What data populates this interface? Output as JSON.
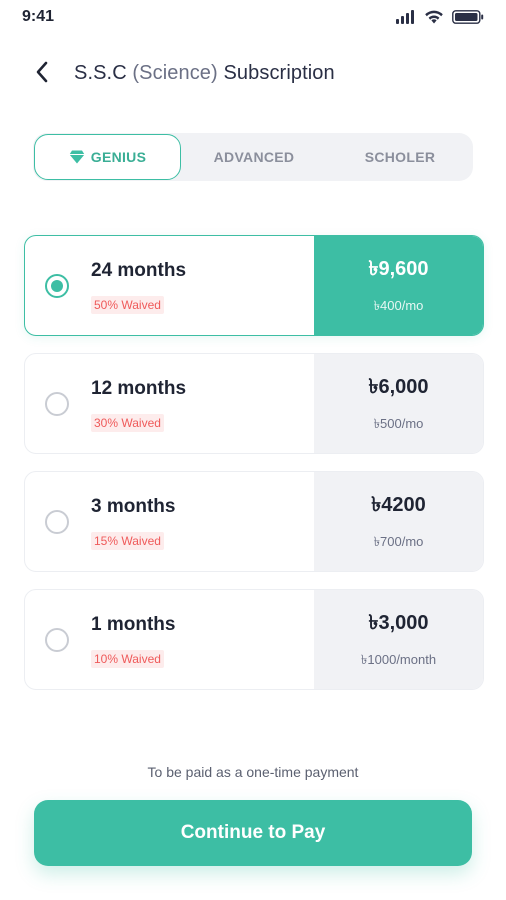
{
  "status_bar": {
    "time": "9:41"
  },
  "header": {
    "title_prefix": "S.S.C",
    "title_paren": "(Science)",
    "title_suffix": "Subscription"
  },
  "tabs": [
    {
      "label": "GENIUS",
      "active": true,
      "icon": "gem-icon"
    },
    {
      "label": "ADVANCED",
      "active": false
    },
    {
      "label": "SCHOLER",
      "active": false
    }
  ],
  "plans": [
    {
      "duration": "24 months",
      "waived": "50% Waived",
      "price": "৳9,600",
      "per": "৳400/mo",
      "selected": true
    },
    {
      "duration": "12 months",
      "waived": "30% Waived",
      "price": "৳6,000",
      "per": "৳500/mo",
      "selected": false
    },
    {
      "duration": "3 months",
      "waived": "15% Waived",
      "price": "৳4200",
      "per": "৳700/mo",
      "selected": false
    },
    {
      "duration": "1 months",
      "waived": "10% Waived",
      "price": "৳3,000",
      "per": "৳1000/month",
      "selected": false
    }
  ],
  "footer": {
    "note": "To be paid as a one-time payment",
    "button_label": "Continue to Pay"
  },
  "colors": {
    "accent": "#3dbea4",
    "waived_text": "#ef5a5a",
    "price_box": "#f1f2f5"
  }
}
